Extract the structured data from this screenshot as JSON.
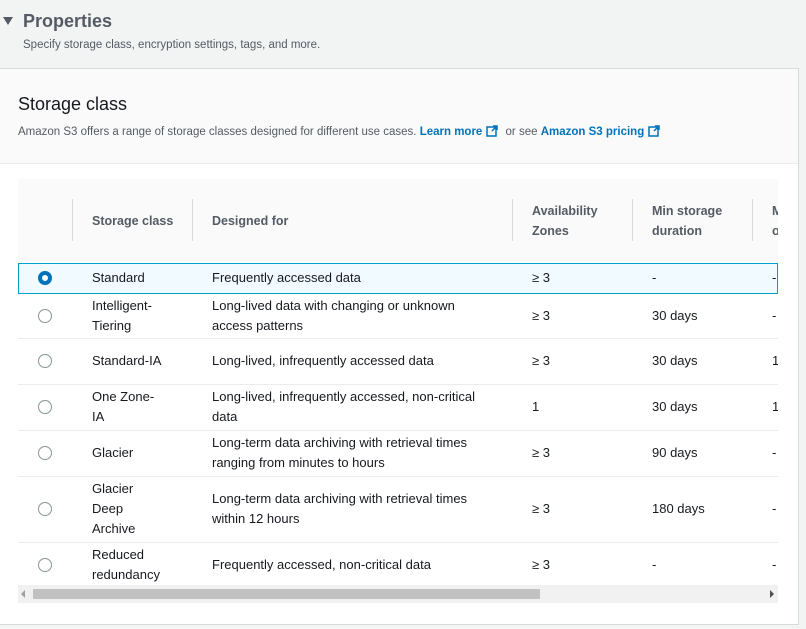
{
  "properties": {
    "title": "Properties",
    "subtitle": "Specify storage class, encryption settings, tags, and more."
  },
  "storage_class": {
    "title": "Storage class",
    "description": "Amazon S3 offers a range of storage classes designed for different use cases.",
    "learn_more": "Learn more",
    "or_see": "or see",
    "pricing_link": "Amazon S3 pricing"
  },
  "table": {
    "columns": [
      "Storage class",
      "Designed for",
      "Availability Zones",
      "Min storage duration",
      "Min billable object size"
    ],
    "rows": [
      {
        "selected": true,
        "class": "Standard",
        "designed_for": "Frequently accessed data",
        "az": "≥ 3",
        "min_duration": "-",
        "min_size": "-"
      },
      {
        "selected": false,
        "class": "Intelligent-Tiering",
        "designed_for": "Long-lived data with changing or unknown access patterns",
        "az": "≥ 3",
        "min_duration": "30 days",
        "min_size": "-"
      },
      {
        "selected": false,
        "class": "Standard-IA",
        "designed_for": "Long-lived, infrequently accessed data",
        "az": "≥ 3",
        "min_duration": "30 days",
        "min_size": "1"
      },
      {
        "selected": false,
        "class": "One Zone-IA",
        "designed_for": "Long-lived, infrequently accessed, non-critical data",
        "az": "1",
        "min_duration": "30 days",
        "min_size": "1"
      },
      {
        "selected": false,
        "class": "Glacier",
        "designed_for": "Long-term data archiving with retrieval times ranging from minutes to hours",
        "az": "≥ 3",
        "min_duration": "90 days",
        "min_size": "-"
      },
      {
        "selected": false,
        "class": "Glacier Deep Archive",
        "designed_for": "Long-term data archiving with retrieval times within 12 hours",
        "az": "≥ 3",
        "min_duration": "180 days",
        "min_size": "-"
      },
      {
        "selected": false,
        "class": "Reduced redundancy",
        "designed_for": "Frequently accessed, non-critical data",
        "az": "≥ 3",
        "min_duration": "-",
        "min_size": "-"
      }
    ]
  },
  "colors": {
    "link": "#0073bb",
    "selected_border": "#00a1c9",
    "selected_bg": "#f1faff"
  }
}
